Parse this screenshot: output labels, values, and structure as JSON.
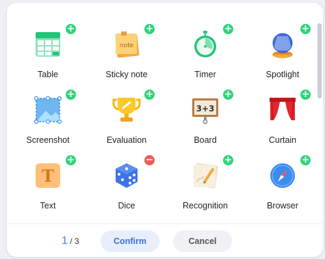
{
  "tools": [
    {
      "label": "Table",
      "icon": "table-icon",
      "action": "add"
    },
    {
      "label": "Sticky note",
      "icon": "sticky-note-icon",
      "action": "add",
      "icon_text": "note"
    },
    {
      "label": "Timer",
      "icon": "timer-icon",
      "action": "add"
    },
    {
      "label": "Spotlight",
      "icon": "spotlight-icon",
      "action": "add"
    },
    {
      "label": "Screenshot",
      "icon": "screenshot-icon",
      "action": "add"
    },
    {
      "label": "Evaluation",
      "icon": "trophy-icon",
      "action": "add"
    },
    {
      "label": "Board",
      "icon": "board-icon",
      "action": "add",
      "icon_text": "3+3"
    },
    {
      "label": "Curtain",
      "icon": "curtain-icon",
      "action": "add"
    },
    {
      "label": "Text",
      "icon": "text-icon",
      "action": "add",
      "icon_text": "T"
    },
    {
      "label": "Dice",
      "icon": "dice-icon",
      "action": "remove"
    },
    {
      "label": "Recognition",
      "icon": "recognition-icon",
      "action": "add"
    },
    {
      "label": "Browser",
      "icon": "compass-icon",
      "action": "add"
    }
  ],
  "badges": {
    "add": "+",
    "remove": "−"
  },
  "pager": {
    "current": "1",
    "total": "/ 3"
  },
  "footer": {
    "confirm_label": "Confirm",
    "cancel_label": "Cancel"
  },
  "colors": {
    "accent": "#3b82f6",
    "add": "#2ed47a",
    "remove": "#f05a5a"
  }
}
